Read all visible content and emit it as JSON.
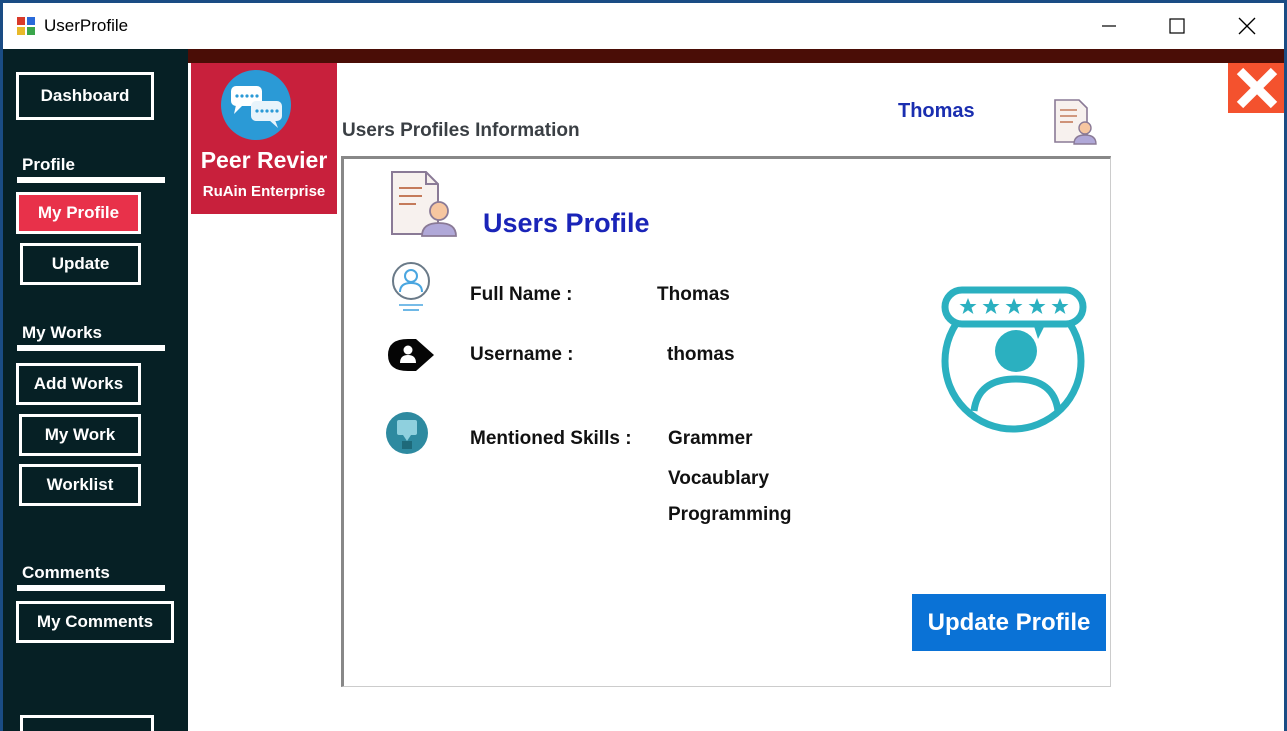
{
  "window": {
    "title": "UserProfile"
  },
  "sidebar": {
    "dashboard": "Dashboard",
    "profile_section": "Profile",
    "my_profile": "My Profile",
    "update": "Update",
    "works_section": "My Works",
    "add_works": "Add Works",
    "my_work": "My Work",
    "worklist": "Worklist",
    "comments_section": "Comments",
    "my_comments": "My Comments"
  },
  "brand": {
    "title": "Peer Revier",
    "subtitle": "RuAin Enterprise"
  },
  "header": {
    "info_title": "Users Profiles Information",
    "user": "Thomas"
  },
  "profile": {
    "heading": "Users Profile",
    "full_name_label": "Full Name :",
    "full_name": "Thomas",
    "username_label": "Username :",
    "username": "thomas",
    "skills_label": "Mentioned Skills :",
    "skills": [
      "Grammer",
      "Vocaublary",
      "Programming"
    ],
    "update_button": "Update Profile"
  },
  "icons": [
    "app-icon",
    "minimize-icon",
    "maximize-icon",
    "close-icon",
    "chat-bubbles-icon",
    "close-x-icon",
    "profile-document-icon",
    "user-circle-icon",
    "user-tag-icon",
    "chat-circle-icon",
    "rated-user-icon"
  ],
  "colors": {
    "sidebar": "#062025",
    "brand": "#c8203c",
    "accent_blue": "#0a72d6",
    "active_nav": "#e8314a",
    "close_x": "#f4522e",
    "teal": "#2bb0c0"
  }
}
